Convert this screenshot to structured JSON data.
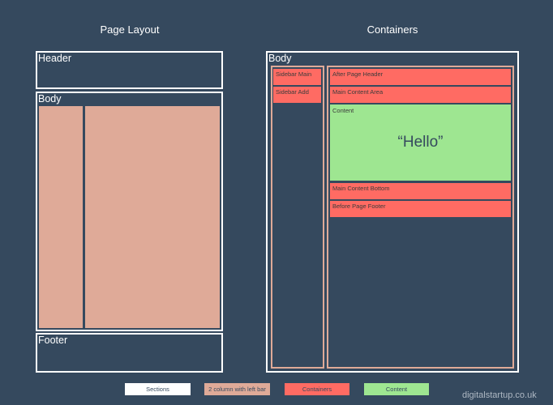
{
  "colors": {
    "background": "#35495e",
    "sections": "#ffffff",
    "two_column": "#dfaa98",
    "containers": "#ff6b63",
    "content": "#9ee691"
  },
  "page_layout": {
    "title": "Page Layout",
    "header": "Header",
    "body": "Body",
    "footer": "Footer"
  },
  "containers_panel": {
    "title": "Containers",
    "body": "Body",
    "sidebar": [
      "Sidebar Main",
      "Sidebar Add"
    ],
    "main_top": [
      "After Page Header",
      "Main Content Area"
    ],
    "content_label": "Content",
    "content_text": "“Hello”",
    "main_bottom": [
      "Main Content Bottom",
      "Before Page Footer"
    ]
  },
  "legend": [
    "Sections",
    "2 column with left bar",
    "Containers",
    "Content"
  ],
  "credit": "digitalstartup.co.uk"
}
